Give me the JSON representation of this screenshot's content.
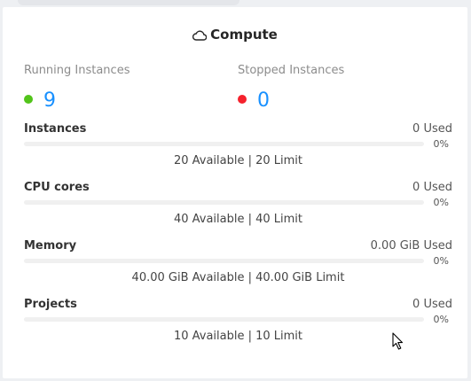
{
  "panel": {
    "title": "Compute",
    "title_icon": "cloud-icon"
  },
  "stats": {
    "running": {
      "label": "Running Instances",
      "value": "9",
      "color": "#52c41a"
    },
    "stopped": {
      "label": "Stopped Instances",
      "value": "0",
      "color": "#f5222d"
    }
  },
  "quotas": [
    {
      "name": "Instances",
      "used": "0 Used",
      "percent_text": "0%",
      "percent": 0,
      "available": "20 Available | 20 Limit"
    },
    {
      "name": "CPU cores",
      "used": "0 Used",
      "percent_text": "0%",
      "percent": 0,
      "available": "40 Available | 40 Limit"
    },
    {
      "name": "Memory",
      "used": "0.00 GiB Used",
      "percent_text": "0%",
      "percent": 0,
      "available": "40.00 GiB Available | 40.00 GiB Limit"
    },
    {
      "name": "Projects",
      "used": "0 Used",
      "percent_text": "0%",
      "percent": 0,
      "available": "10 Available | 10 Limit"
    }
  ],
  "colors": {
    "accent": "#1890ff",
    "track": "#f0f0f0"
  }
}
